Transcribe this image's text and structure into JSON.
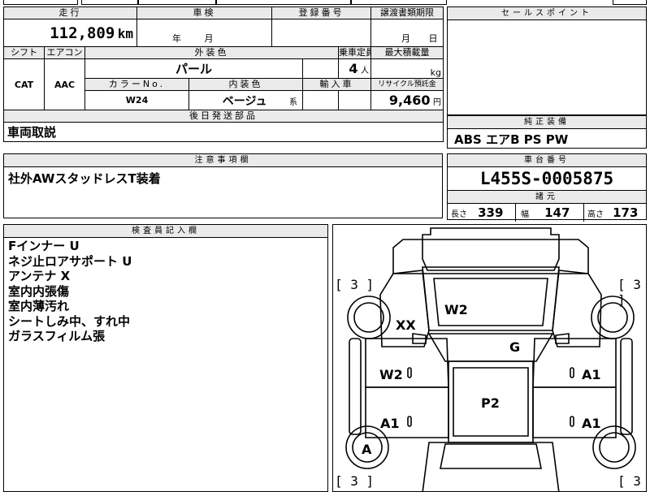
{
  "top_cut": {
    "left_text": "",
    "mid_text": ""
  },
  "main": {
    "mileage_label": "走行",
    "mileage_value": "112,809",
    "mileage_unit": "km",
    "inspection_label": "車検",
    "inspection_year": "年",
    "inspection_month": "月",
    "registration_label": "登録番号",
    "registration_value": "",
    "transfer_label": "譲渡書類期限",
    "transfer_month": "月",
    "transfer_day": "日",
    "shift_label": "シフト",
    "shift_value": "CAT",
    "aircon_label": "エアコン",
    "aircon_value": "AAC",
    "exterior_color_label": "外装色",
    "exterior_color_value": "パール",
    "capacity_label": "乗車定員",
    "capacity_value": "4",
    "capacity_unit": "人",
    "max_load_label": "最大積載量",
    "max_load_unit": "kg",
    "color_no_label": "カラーNo.",
    "color_no_value": "W24",
    "interior_color_label": "内装色",
    "interior_color_value": "ベージュ",
    "interior_color_suffix": "系",
    "import_label": "輸入車",
    "recycle_label": "リサイクル預託金",
    "recycle_value": "9,460",
    "recycle_unit": "円",
    "delivery_parts_label": "後日発送部品",
    "delivery_parts_value": "車両取説"
  },
  "sales": {
    "label": "セールスポイント",
    "value": ""
  },
  "equipment": {
    "label": "純正装備",
    "value": "ABS エアB PS PW"
  },
  "notes": {
    "label": "注意事項欄",
    "value": "社外AWスタッドレスT装着"
  },
  "chassis": {
    "label": "車台番号",
    "value": "L455S-0005875",
    "spec_label": "諸元",
    "length_label": "長さ",
    "length_value": "339",
    "width_label": "幅",
    "width_value": "147",
    "height_label": "高さ",
    "height_value": "173"
  },
  "inspector": {
    "label": "検査員記入欄",
    "lines": [
      "Fインナー U",
      "ネジ止ロアサポート U",
      "アンテナ X",
      "室内内張傷",
      "室内薄汚れ",
      "シートしみ中、すれ中",
      "ガラスフィルム張"
    ]
  },
  "diagram": {
    "bracket_value": "3",
    "marks": {
      "hood": "W2",
      "front_left": "XX",
      "windshield": "G",
      "left_front_door": "W2",
      "right_front_door": "A1",
      "roof": "P2",
      "left_rear_door": "A1",
      "right_rear_door": "A1",
      "left_rear_wheel": "A"
    }
  }
}
